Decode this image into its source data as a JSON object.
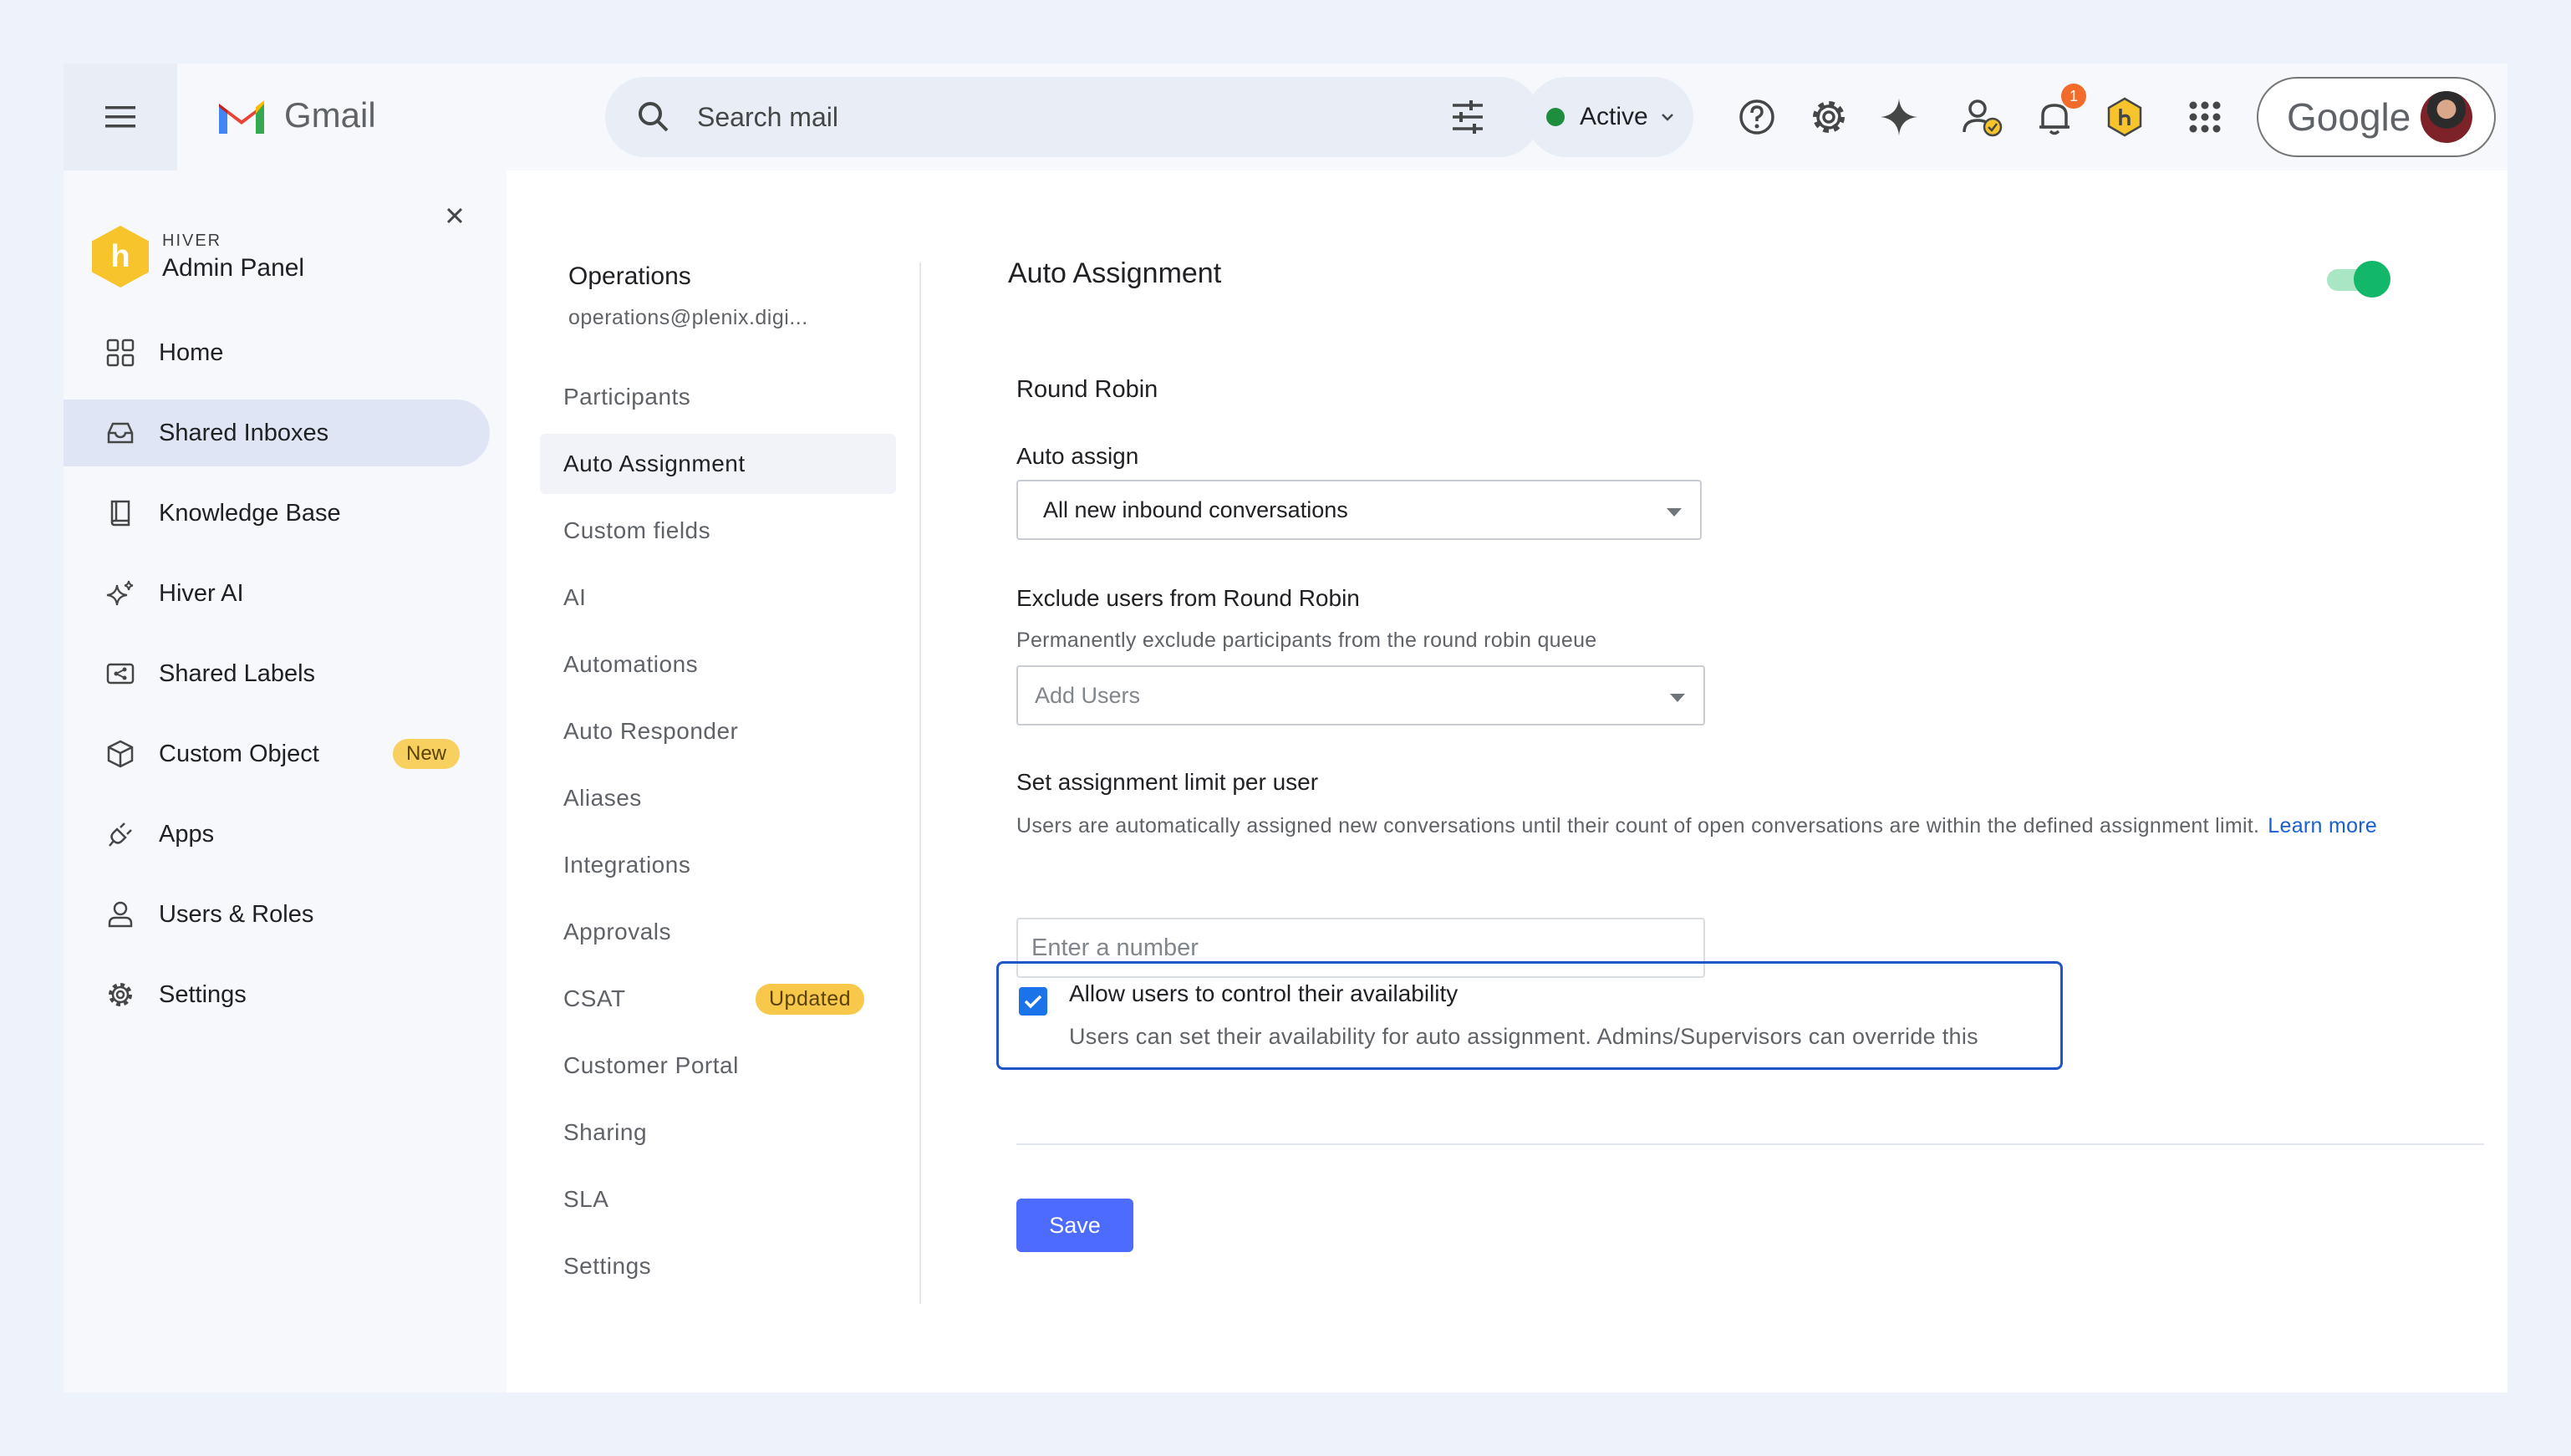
{
  "topbar": {
    "app_name": "Gmail",
    "search_placeholder": "Search mail",
    "status_label": "Active",
    "notification_count": "1",
    "account_brand": "Google"
  },
  "sidebar": {
    "brand_small": "HIVER",
    "brand_title": "Admin Panel",
    "items": [
      {
        "label": "Home"
      },
      {
        "label": "Shared Inboxes"
      },
      {
        "label": "Knowledge Base"
      },
      {
        "label": "Hiver AI"
      },
      {
        "label": "Shared Labels"
      },
      {
        "label": "Custom Object",
        "badge": "New"
      },
      {
        "label": "Apps"
      },
      {
        "label": "Users & Roles"
      },
      {
        "label": "Settings"
      }
    ]
  },
  "inbox": {
    "name": "Operations",
    "email": "operations@plenix.digi..."
  },
  "subnav": {
    "items": [
      {
        "label": "Participants"
      },
      {
        "label": "Auto Assignment"
      },
      {
        "label": "Custom fields"
      },
      {
        "label": "AI"
      },
      {
        "label": "Automations"
      },
      {
        "label": "Auto Responder"
      },
      {
        "label": "Aliases"
      },
      {
        "label": "Integrations"
      },
      {
        "label": "Approvals"
      },
      {
        "label": "CSAT",
        "badge": "Updated"
      },
      {
        "label": "Customer Portal"
      },
      {
        "label": "Sharing"
      },
      {
        "label": "SLA"
      },
      {
        "label": "Settings"
      }
    ]
  },
  "content": {
    "title": "Auto Assignment",
    "toggle_on": true,
    "section_title": "Round Robin",
    "auto_assign_label": "Auto assign",
    "auto_assign_value": "All new inbound conversations",
    "exclude_label": "Exclude users from Round Robin",
    "exclude_help": "Permanently exclude participants from the round robin queue",
    "exclude_placeholder": "Add Users",
    "limit_label": "Set assignment limit per user",
    "limit_help": "Users are automatically assigned new conversations until their count of open conversations are within the defined assignment limit.",
    "learn_more": "Learn more",
    "limit_placeholder": "Enter a number",
    "availability_title": "Allow users to control their availability",
    "availability_desc": "Users can set their availability for auto assignment. Admins/Supervisors can override this",
    "availability_checked": true,
    "save_label": "Save"
  },
  "colors": {
    "accent": "#4d6bfe",
    "toggle": "#12b76a",
    "highlight_border": "#1f55c8"
  }
}
